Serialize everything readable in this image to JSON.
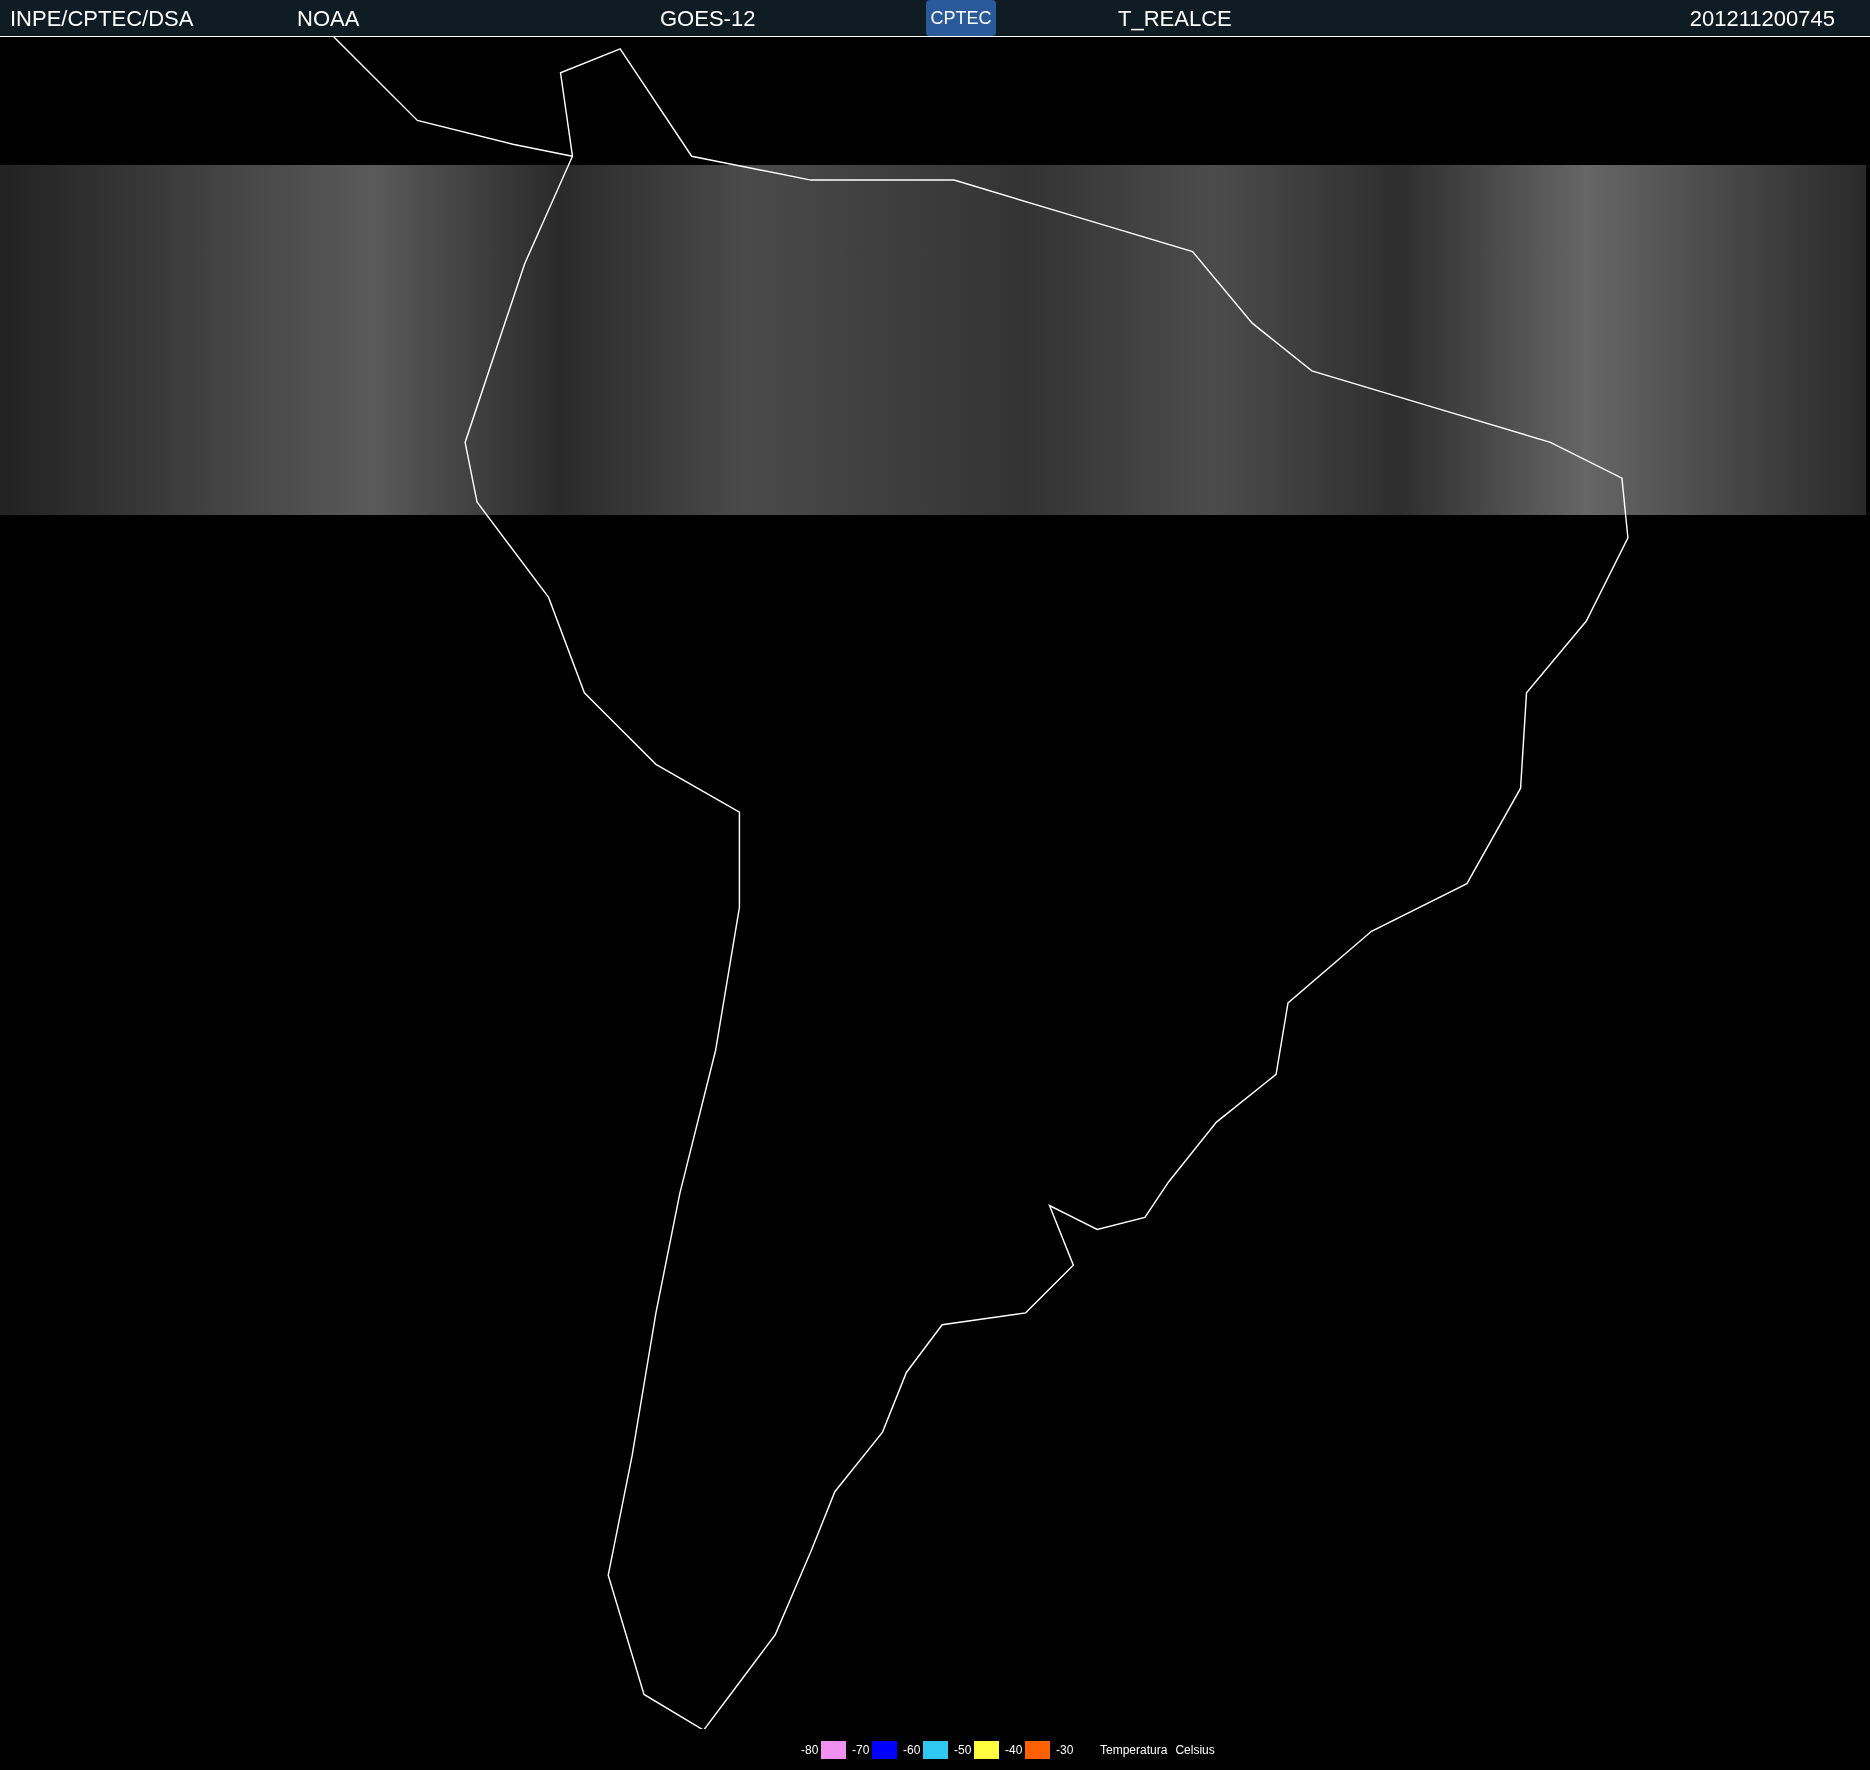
{
  "header": {
    "items": [
      "INPE/CPTEC/DSA",
      "NOAA",
      "GOES-12"
    ],
    "logo": "CPTEC",
    "product": "T_REALCE",
    "timestamp": "201211200745"
  },
  "legend": {
    "labels": [
      "-80",
      "-70",
      "-60",
      "-50",
      "-40",
      "-30"
    ],
    "swatches": [
      {
        "color": "#f090f0"
      },
      {
        "color": "#0000ff"
      },
      {
        "color": "#30c8f0"
      },
      {
        "color": "#ffff40"
      },
      {
        "color": "#ff6000"
      }
    ],
    "title": "Temperatura",
    "unit": "Celsius"
  }
}
